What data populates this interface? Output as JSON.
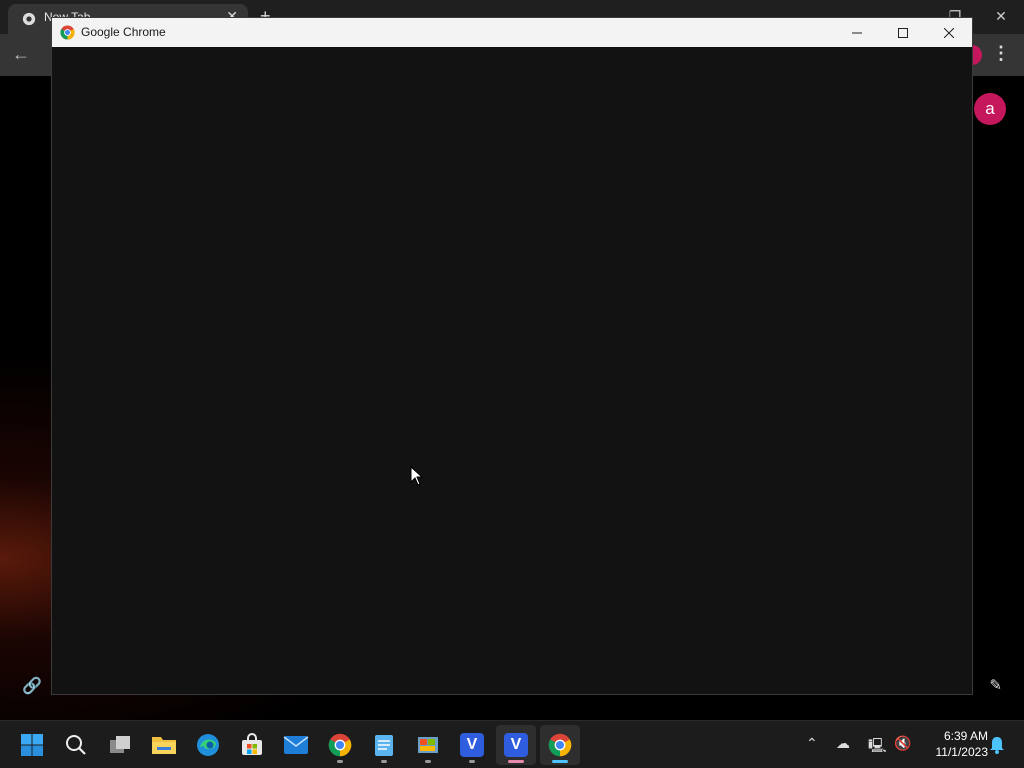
{
  "background_window": {
    "tab_title": "New Tab",
    "avatar_letter": "a"
  },
  "dialog": {
    "title": "Google Chrome"
  },
  "taskbar": {
    "time": "6:39 AM",
    "date": "11/1/2023",
    "apps": [
      {
        "name": "start",
        "label": ""
      },
      {
        "name": "search",
        "label": ""
      },
      {
        "name": "task-view",
        "label": ""
      },
      {
        "name": "file-explorer",
        "label": ""
      },
      {
        "name": "edge",
        "label": ""
      },
      {
        "name": "store",
        "label": ""
      },
      {
        "name": "mail",
        "label": ""
      },
      {
        "name": "chrome",
        "label": ""
      },
      {
        "name": "notepad",
        "label": ""
      },
      {
        "name": "paint",
        "label": ""
      },
      {
        "name": "v-app",
        "label": "V"
      },
      {
        "name": "v-app-2",
        "label": "V"
      },
      {
        "name": "chrome-2",
        "label": ""
      }
    ]
  }
}
